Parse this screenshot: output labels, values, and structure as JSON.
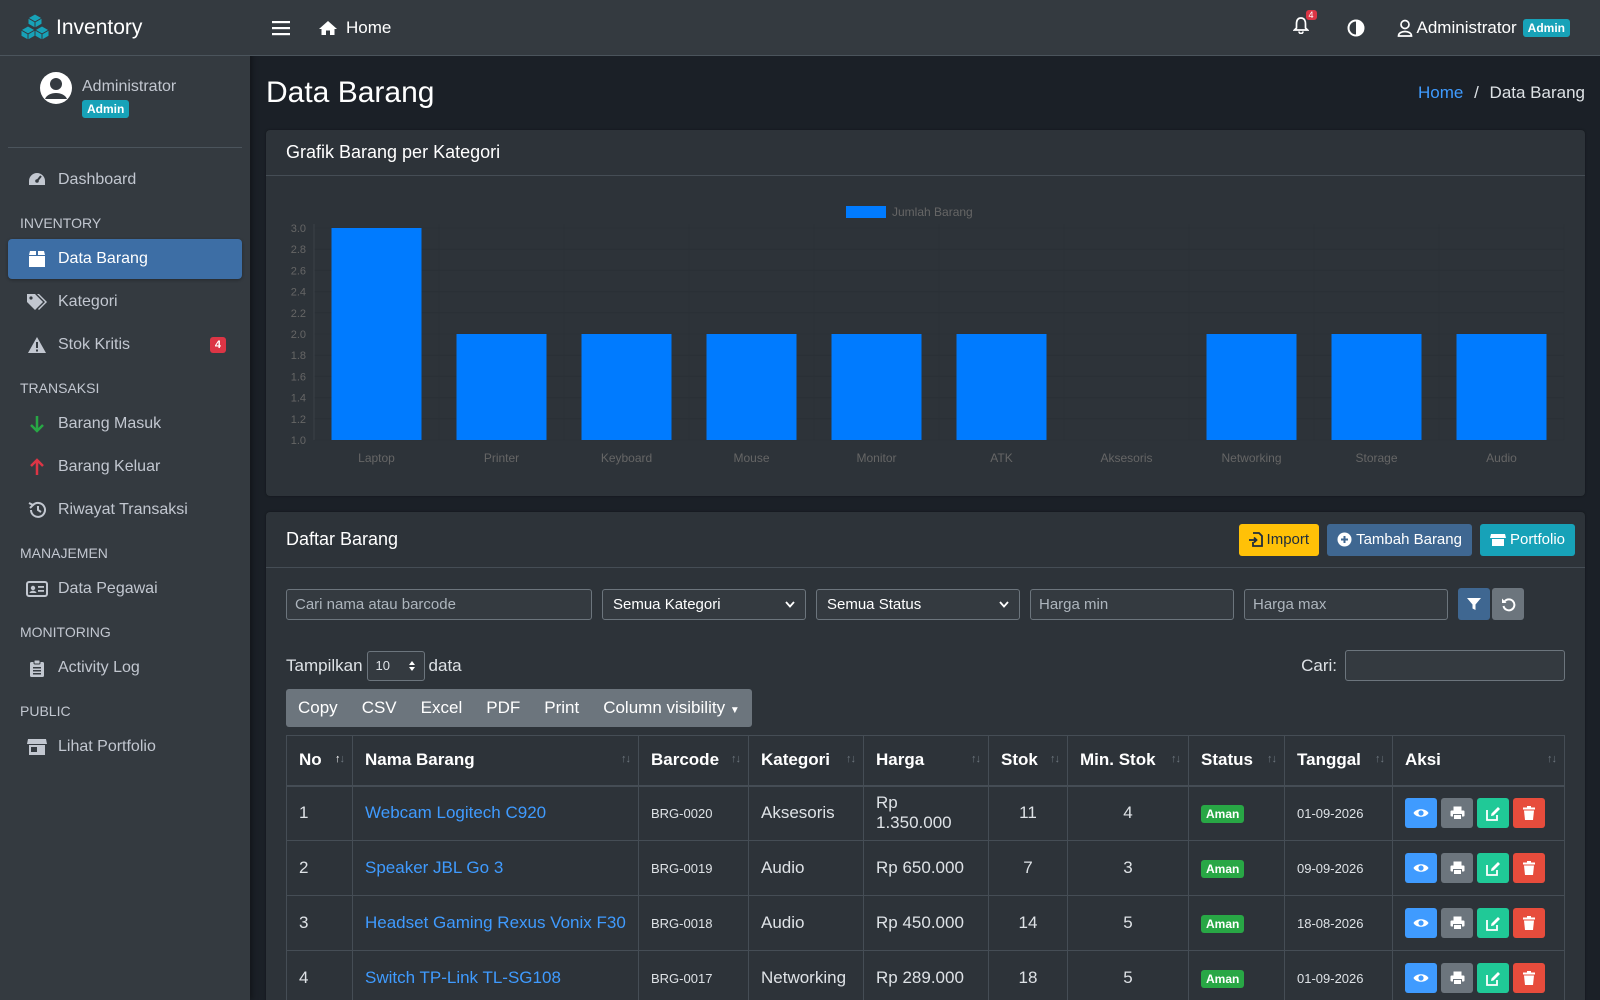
{
  "brand": {
    "name": "Inventory"
  },
  "user": {
    "name": "Administrator",
    "role": "Admin"
  },
  "nav": {
    "dashboard": "Dashboard",
    "h_inventory": "INVENTORY",
    "data_barang": "Data Barang",
    "kategori": "Kategori",
    "stok_kritis": "Stok Kritis",
    "stok_kritis_count": "4",
    "h_transaksi": "TRANSAKSI",
    "barang_masuk": "Barang Masuk",
    "barang_keluar": "Barang Keluar",
    "riwayat": "Riwayat Transaksi",
    "h_manajemen": "MANAJEMEN",
    "pegawai": "Data Pegawai",
    "h_monitoring": "MONITORING",
    "activity": "Activity Log",
    "h_public": "PUBLIC",
    "portfolio": "Lihat Portfolio"
  },
  "topbar": {
    "home": "Home",
    "notif_count": "4",
    "user": "Administrator",
    "role": "Admin"
  },
  "page": {
    "title": "Data Barang",
    "crumb_home": "Home",
    "crumb_sep": "/",
    "crumb_current": "Data Barang"
  },
  "chart_card": {
    "title": "Grafik Barang per Kategori"
  },
  "chart_data": {
    "type": "bar",
    "categories": [
      "Laptop",
      "Printer",
      "Keyboard",
      "Mouse",
      "Monitor",
      "ATK",
      "Aksesoris",
      "Networking",
      "Storage",
      "Audio"
    ],
    "series": [
      {
        "name": "Jumlah Barang",
        "values": [
          3,
          2,
          2,
          2,
          2,
          2,
          1,
          2,
          2,
          2
        ]
      }
    ],
    "ylim": [
      1.0,
      3.0
    ],
    "yticks": [
      "3.0",
      "2.8",
      "2.6",
      "2.4",
      "2.2",
      "2.0",
      "1.8",
      "1.6",
      "1.4",
      "1.2",
      "1.0"
    ],
    "legend": "top-center",
    "color": "#007bff"
  },
  "list": {
    "title": "Daftar Barang",
    "import": "Import",
    "add": "Tambah Barang",
    "portfolio": "Portfolio"
  },
  "filters": {
    "search_placeholder": "Cari nama atau barcode",
    "kategori": "Semua Kategori",
    "status": "Semua Status",
    "min_placeholder": "Harga min",
    "max_placeholder": "Harga max"
  },
  "dt": {
    "show": "Tampilkan",
    "length": "10",
    "data": "data",
    "search": "Cari:",
    "buttons": [
      "Copy",
      "CSV",
      "Excel",
      "PDF",
      "Print",
      "Column visibility"
    ]
  },
  "table": {
    "headers": [
      "No",
      "Nama Barang",
      "Barcode",
      "Kategori",
      "Harga",
      "Stok",
      "Min. Stok",
      "Status",
      "Tanggal",
      "Aksi"
    ],
    "rows": [
      {
        "no": "1",
        "nama": "Webcam Logitech C920",
        "barcode": "BRG-0020",
        "kategori": "Aksesoris",
        "harga": "Rp 1.350.000",
        "stok": "11",
        "min": "4",
        "status": "Aman",
        "tanggal": "01-09-2026"
      },
      {
        "no": "2",
        "nama": "Speaker JBL Go 3",
        "barcode": "BRG-0019",
        "kategori": "Audio",
        "harga": "Rp 650.000",
        "stok": "7",
        "min": "3",
        "status": "Aman",
        "tanggal": "09-09-2026"
      },
      {
        "no": "3",
        "nama": "Headset Gaming Rexus Vonix F30",
        "barcode": "BRG-0018",
        "kategori": "Audio",
        "harga": "Rp 450.000",
        "stok": "14",
        "min": "5",
        "status": "Aman",
        "tanggal": "18-08-2026"
      },
      {
        "no": "4",
        "nama": "Switch TP-Link TL-SG108",
        "barcode": "BRG-0017",
        "kategori": "Networking",
        "harga": "Rp 289.000",
        "stok": "18",
        "min": "5",
        "status": "Aman",
        "tanggal": "01-09-2026"
      }
    ]
  },
  "colors": {
    "accent": "#3d6ea5",
    "link": "#3f9bff",
    "success": "#28a745",
    "danger": "#dc3545",
    "warning": "#ffc107",
    "info": "#17a2b8"
  }
}
